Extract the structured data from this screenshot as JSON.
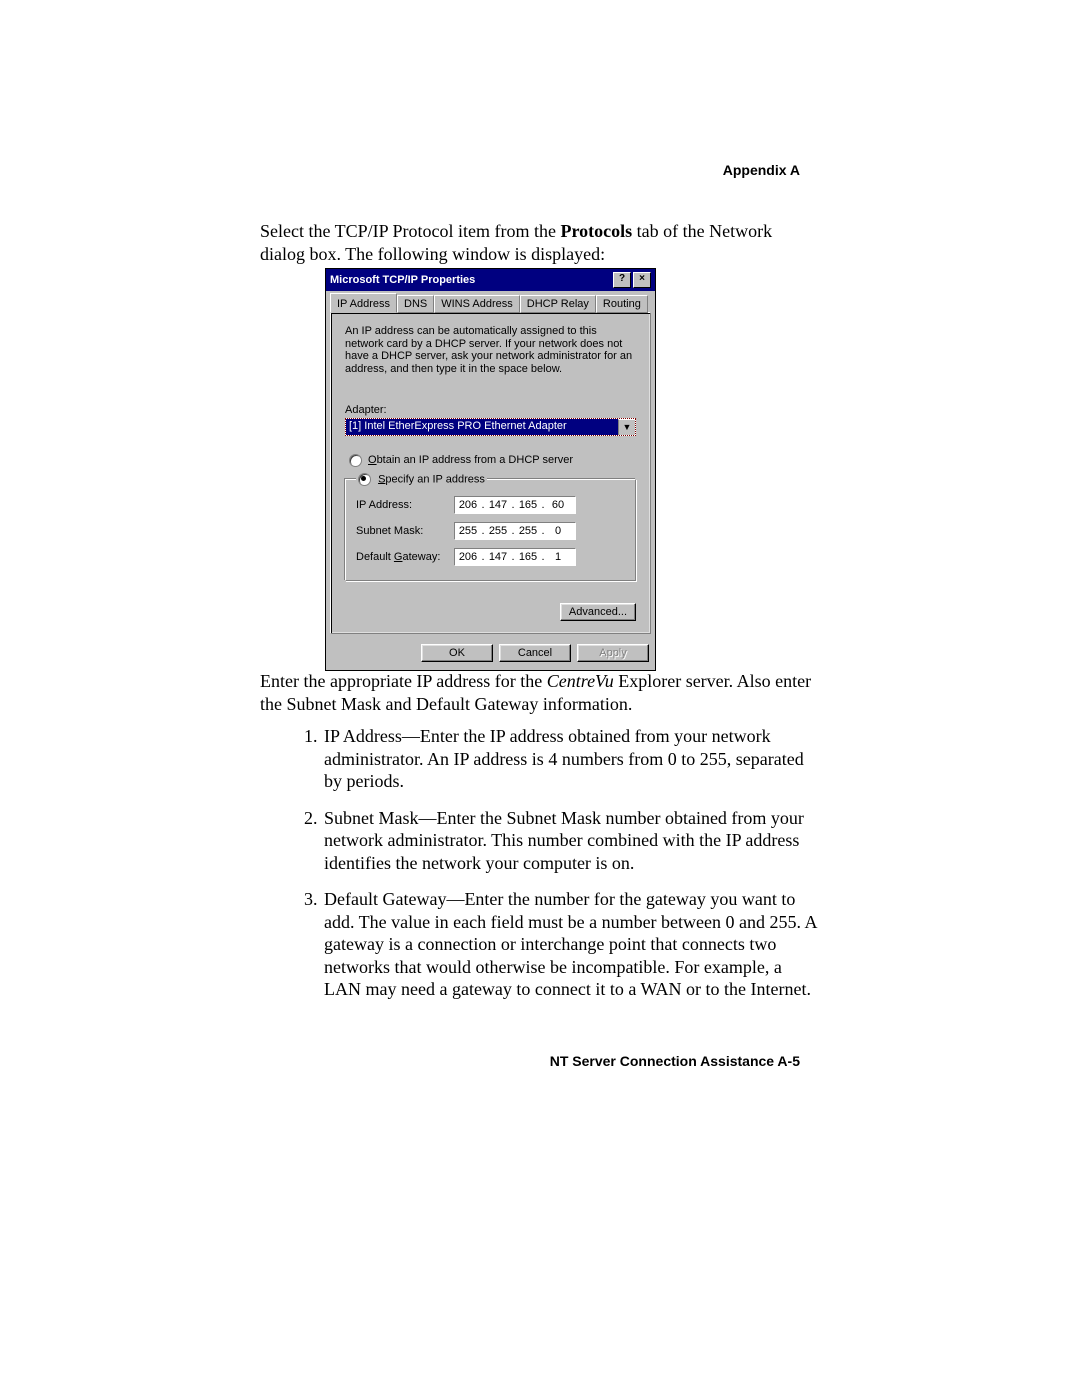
{
  "header": "Appendix A",
  "intro": {
    "s1a": "Select the TCP/IP Protocol item from the ",
    "s1b": "Protocols",
    "s1c": " tab of the Network dialog box. The following window is displayed:"
  },
  "dialog": {
    "title": "Microsoft TCP/IP Properties",
    "help_glyph": "?",
    "close_glyph": "×",
    "tabs": {
      "ip": "IP Address",
      "dns": "DNS",
      "wins": "WINS Address",
      "dhcp": "DHCP Relay",
      "routing": "Routing"
    },
    "description": "An IP address can be automatically assigned to this network card by a DHCP server.  If your network does not have a DHCP server, ask your network administrator for an address, and then type it in the space below.",
    "adapter_label": "Adapter:",
    "adapter_value": "[1] Intel EtherExpress PRO Ethernet Adapter",
    "dropdown_glyph": "▼",
    "radio_obtain": "Obtain an IP address from a DHCP server",
    "radio_specify": "Specify an IP address",
    "fields": {
      "ip_label": "IP Address:",
      "ip": {
        "o1": "206",
        "o2": "147",
        "o3": "165",
        "o4": "60"
      },
      "mask_label": "Subnet Mask:",
      "mask": {
        "o1": "255",
        "o2": "255",
        "o3": "255",
        "o4": "0"
      },
      "gw_label": "Default Gateway:",
      "gw": {
        "o1": "206",
        "o2": "147",
        "o3": "165",
        "o4": "1"
      },
      "dot": "."
    },
    "advanced": "Advanced...",
    "ok": "OK",
    "cancel": "Cancel",
    "apply": "Apply"
  },
  "after": {
    "p1a": "Enter the appropriate IP address for the ",
    "p1b": "CentreVu",
    "p1c": " Explorer server. Also enter the Subnet Mask and Default Gateway information.",
    "li1": "IP Address—Enter the IP address obtained from your network administrator. An IP address is 4 numbers from 0 to 255, separated by periods.",
    "li2": "Subnet Mask—Enter the Subnet Mask number obtained from your network administrator. This number combined with the IP address identifies the network your computer is on.",
    "li3": "Default Gateway—Enter the number for the gateway you want to add. The value in each field must be a number between 0 and 255. A gateway is a connection or interchange point that connects two networks that would otherwise be incompatible. For example, a LAN may need a gateway to connect it to a WAN or to the Internet."
  },
  "footer": "NT Server Connection Assistance  A-5"
}
